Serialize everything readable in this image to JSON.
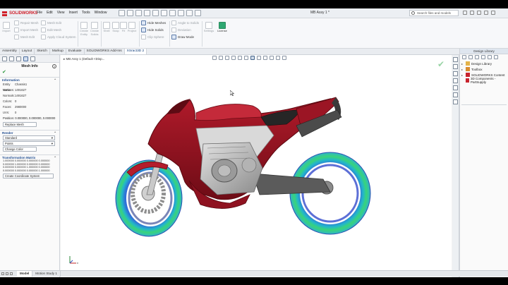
{
  "app": {
    "logo_text": "SOLIDWORKS",
    "document_title": "MB Assy 1 *",
    "menu": [
      "File",
      "Edit",
      "View",
      "Insert",
      "Tools",
      "Window"
    ],
    "search_placeholder": "Search files and models"
  },
  "command_manager": {
    "mesh_tools": [
      {
        "label": "Import"
      },
      {
        "label": "Repair Mesh"
      },
      {
        "label": "Import Mesh"
      },
      {
        "label": "Mesh Edit"
      },
      {
        "label": "Edit Mesh"
      },
      {
        "label": "Apply Cloud System"
      }
    ],
    "col2": [
      {
        "label": "Create Entity"
      },
      {
        "label": "Create Solids"
      }
    ],
    "col3": [
      {
        "label": "Shell"
      },
      {
        "label": "Snap"
      },
      {
        "label": "Fit"
      },
      {
        "label": "Project"
      }
    ],
    "display": [
      {
        "label": "Hide Meshes"
      },
      {
        "label": "Hide Solids"
      },
      {
        "label": "Clip Sphere"
      }
    ],
    "right_group": [
      {
        "label": "Angle to Solids"
      },
      {
        "label": "Deviation"
      },
      {
        "label": "Draw Mode"
      }
    ],
    "settings_label": "Settings",
    "license_label": "License"
  },
  "tabs": [
    {
      "label": "Assembly",
      "active": false
    },
    {
      "label": "Layout",
      "active": false
    },
    {
      "label": "Sketch",
      "active": false
    },
    {
      "label": "Markup",
      "active": false
    },
    {
      "label": "Evaluate",
      "active": false
    },
    {
      "label": "SOLIDWORKS Add-Ins",
      "active": false
    },
    {
      "label": "XSract3D 2",
      "active": true
    }
  ],
  "property_manager": {
    "title": "Mesh Info",
    "information": {
      "title": "Information",
      "rows": [
        {
          "key": "Entity Name",
          "value": "Chassis1"
        },
        {
          "key": "Vertices:",
          "value": "1491627"
        },
        {
          "key": "Normals:",
          "value": "1491627"
        },
        {
          "key": "Colors:",
          "value": "0"
        },
        {
          "key": "Faces:",
          "value": "2980000"
        },
        {
          "key": "UVs:",
          "value": "0"
        }
      ],
      "position": "Position: 0.000000, 0.000000, 0.000000",
      "replace_button": "Replace Mesh"
    },
    "render": {
      "title": "Render",
      "mode": "Standard",
      "points": "Points",
      "change_color_button": "Change Color"
    },
    "transformation": {
      "title": "Transformation Matrix",
      "rows": [
        "1.000000 0.000000 0.000000 0.000000",
        "0.000000 1.000000 0.000000 0.000000",
        "0.000000 0.000000 1.000000 0.000000",
        "0.000000 0.000000 0.000000 1.000000"
      ],
      "create_button": "Create Coordinate System"
    }
  },
  "graphics": {
    "tree_flyout": "MB Assy 1 (Default <Disp..."
  },
  "task_pane": {
    "title": "Design Library",
    "items": [
      {
        "label": "Design Library",
        "color": "#e3b34a"
      },
      {
        "label": "Toolbox",
        "color": "#d98c2f"
      },
      {
        "label": "SOLIDWORKS Content",
        "color": "#c8232c"
      },
      {
        "label": "3D Components - PartSupply",
        "color": "#c8232c"
      }
    ]
  },
  "bottom_tabs": [
    {
      "label": "Model",
      "active": true
    },
    {
      "label": "Motion Study 1",
      "active": false
    }
  ]
}
